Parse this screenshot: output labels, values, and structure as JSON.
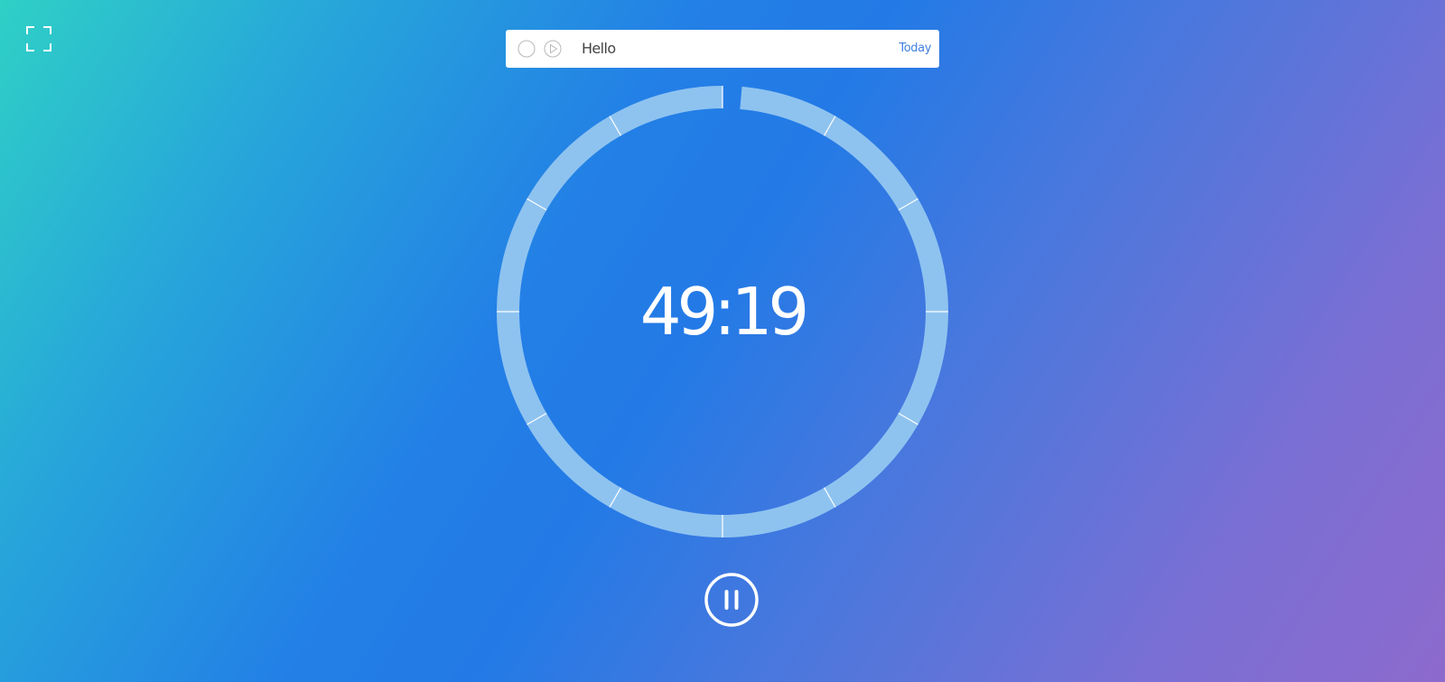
{
  "toolbar": {
    "fullscreen_icon": "fullscreen-icon"
  },
  "task": {
    "title": "Hello",
    "date_label": "Today",
    "check_icon": "circle-checkbox-icon",
    "play_icon": "play-icon"
  },
  "timer": {
    "time": "49:19",
    "elapsed_fraction": 0.0137,
    "segments": 12
  },
  "controls": {
    "pause_icon": "pause-icon"
  },
  "colors": {
    "ring_fill": "#8ec3f0",
    "text": "#ffffff",
    "accent": "#3f7fe0"
  }
}
